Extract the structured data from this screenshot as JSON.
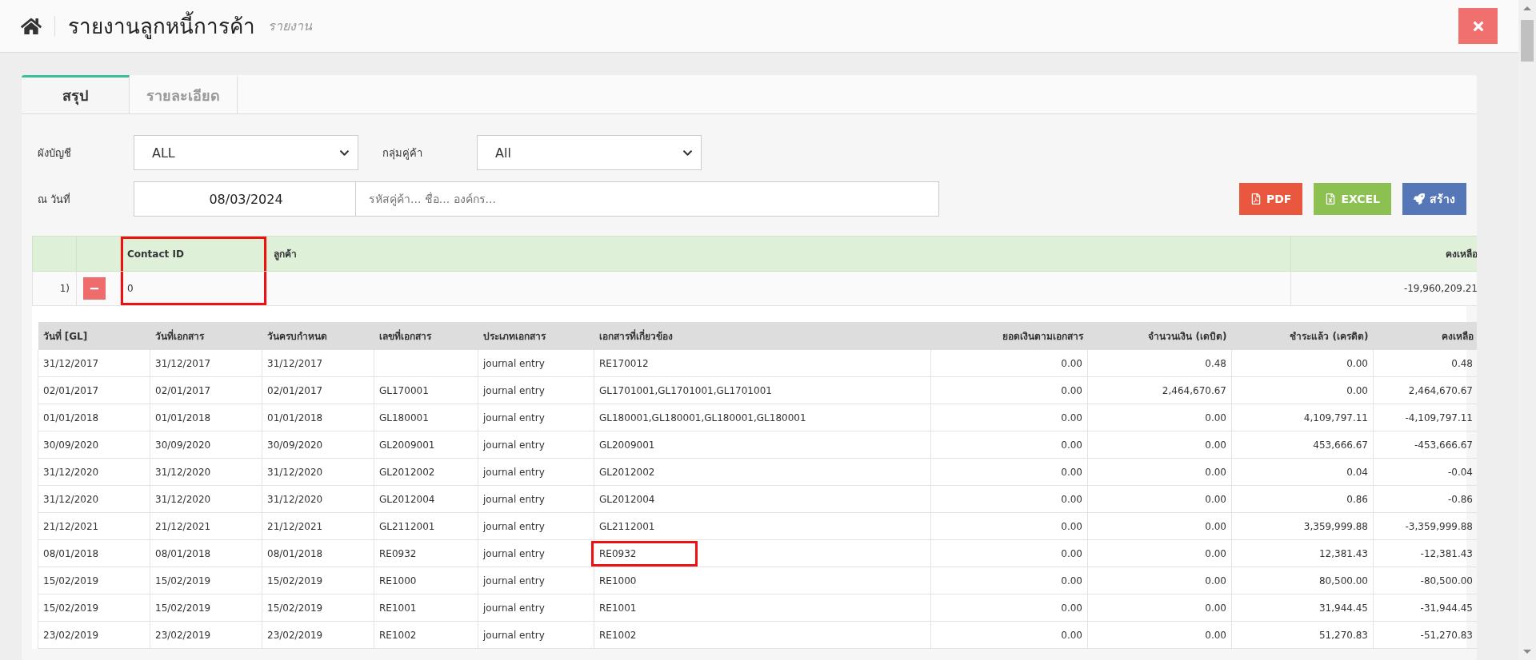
{
  "header": {
    "title": "รายงานลูกหนี้การค้า",
    "subtitle": "รายงาน"
  },
  "tabs": [
    {
      "label": "สรุป",
      "selected": true
    },
    {
      "label": "รายละเอียด",
      "selected": false
    }
  ],
  "filters": {
    "chart_of_accounts": {
      "label": "ผังบัญชี",
      "value": "ALL"
    },
    "customer_group": {
      "label": "กลุ่มคู่ค้า",
      "value": "All"
    },
    "as_of_date": {
      "label": "ณ วันที่",
      "value": "08/03/2024"
    },
    "search": {
      "placeholder": "รหัสคู่ค้า... ชื่อ... องค์กร..."
    }
  },
  "actions": [
    {
      "kind": "pdf",
      "label": "PDF"
    },
    {
      "kind": "excel",
      "label": "EXCEL"
    },
    {
      "kind": "create",
      "label": "สร้าง"
    }
  ],
  "summary": {
    "columns": [
      {
        "highlighted": false
      },
      {
        "highlighted": false
      },
      {
        "label": "Contact ID",
        "highlighted": true
      },
      {
        "label": "ลูกค้า",
        "highlighted": false
      },
      {
        "label": "คงเหลือ",
        "highlighted": false
      }
    ],
    "rows": [
      {
        "index": "1)",
        "expanded": true,
        "contact_id": "0",
        "balance": "-19,960,209.21"
      }
    ]
  },
  "detail": {
    "columns": [
      "วันที่ [GL]",
      "วันที่เอกสาร",
      "วันครบกำหนด",
      "เลขที่เอกสาร",
      "ประเภทเอกสาร",
      "เอกสารที่เกี่ยวข้อง",
      "ยอดเงินตามเอกสาร",
      "จำนวนเงิน (เดบิต)",
      "ชำระแล้ว (เครดิต)",
      "คงเหลือ"
    ],
    "rows": [
      {
        "cells": [
          "31/12/2017",
          "31/12/2017",
          "31/12/2017",
          "",
          "journal entry",
          "RE170012",
          "0.00",
          "0.48",
          "0.00",
          "0.48"
        ],
        "highlighted": false
      },
      {
        "cells": [
          "02/01/2017",
          "02/01/2017",
          "02/01/2017",
          "GL170001",
          "journal entry",
          "GL1701001,GL1701001,GL1701001",
          "0.00",
          "2,464,670.67",
          "0.00",
          "2,464,670.67"
        ],
        "highlighted": false
      },
      {
        "cells": [
          "01/01/2018",
          "01/01/2018",
          "01/01/2018",
          "GL180001",
          "journal entry",
          "GL180001,GL180001,GL180001,GL180001",
          "0.00",
          "0.00",
          "4,109,797.11",
          "-4,109,797.11"
        ],
        "highlighted": false
      },
      {
        "cells": [
          "30/09/2020",
          "30/09/2020",
          "30/09/2020",
          "GL2009001",
          "journal entry",
          "GL2009001",
          "0.00",
          "0.00",
          "453,666.67",
          "-453,666.67"
        ],
        "highlighted": false
      },
      {
        "cells": [
          "31/12/2020",
          "31/12/2020",
          "31/12/2020",
          "GL2012002",
          "journal entry",
          "GL2012002",
          "0.00",
          "0.00",
          "0.04",
          "-0.04"
        ],
        "highlighted": false
      },
      {
        "cells": [
          "31/12/2020",
          "31/12/2020",
          "31/12/2020",
          "GL2012004",
          "journal entry",
          "GL2012004",
          "0.00",
          "0.00",
          "0.86",
          "-0.86"
        ],
        "highlighted": false
      },
      {
        "cells": [
          "21/12/2021",
          "21/12/2021",
          "21/12/2021",
          "GL2112001",
          "journal entry",
          "GL2112001",
          "0.00",
          "0.00",
          "3,359,999.88",
          "-3,359,999.88"
        ],
        "highlighted": false
      },
      {
        "cells": [
          "08/01/2018",
          "08/01/2018",
          "08/01/2018",
          "RE0932",
          "journal entry",
          "RE0932",
          "0.00",
          "0.00",
          "12,381.43",
          "-12,381.43"
        ],
        "highlighted": true
      },
      {
        "cells": [
          "15/02/2019",
          "15/02/2019",
          "15/02/2019",
          "RE1000",
          "journal entry",
          "RE1000",
          "0.00",
          "0.00",
          "80,500.00",
          "-80,500.00"
        ],
        "highlighted": false
      },
      {
        "cells": [
          "15/02/2019",
          "15/02/2019",
          "15/02/2019",
          "RE1001",
          "journal entry",
          "RE1001",
          "0.00",
          "0.00",
          "31,944.45",
          "-31,944.45"
        ],
        "highlighted": false
      },
      {
        "cells": [
          "23/02/2019",
          "23/02/2019",
          "23/02/2019",
          "RE1002",
          "journal entry",
          "RE1002",
          "0.00",
          "0.00",
          "51,270.83",
          "-51,270.83"
        ],
        "highlighted": false
      }
    ]
  }
}
